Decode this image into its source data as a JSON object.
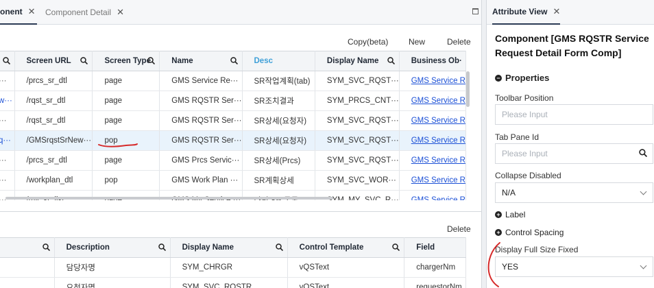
{
  "tabs": [
    {
      "label": "onent",
      "active": true
    },
    {
      "label": "Component Detail",
      "active": false
    }
  ],
  "upper_toolbar": {
    "copy": "Copy(beta)",
    "new": "New",
    "delete": "Delete"
  },
  "upper_grid": {
    "headers": [
      "Screen URL",
      "Screen Type",
      "Name",
      "Desc",
      "Display Name",
      "Business Ob·"
    ],
    "rows": [
      {
        "c0": "···",
        "url": "/prcs_sr_dtl",
        "type": "page",
        "name": "GMS Service Re···",
        "desc": "SR작업계획(tab)",
        "display": "SYM_SVC_RQST···",
        "bo": "GMS Service R"
      },
      {
        "c0": "w···",
        "url": "/rqst_sr_dtl",
        "type": "page",
        "name": "GMS RQSTR Ser···",
        "desc": "SR조치결과",
        "display": "SYM_PRCS_CNT···",
        "bo": "GMS Service R"
      },
      {
        "c0": "···",
        "url": "/rqst_sr_dtl",
        "type": "page",
        "name": "GMS RQSTR Ser···",
        "desc": "SR상세(요청자)",
        "display": "SYM_SVC_RQST···",
        "bo": "GMS Service R"
      },
      {
        "c0": "q···",
        "url": "/GMSrqstSrNew···",
        "type": "pop",
        "name": "GMS RQSTR Ser···",
        "desc": "SR상세(요청자)",
        "display": "SYM_SVC_RQST···",
        "bo": "GMS Service R",
        "selected": true
      },
      {
        "c0": "···",
        "url": "/prcs_sr_dtl",
        "type": "page",
        "name": "GMS Prcs Servic···",
        "desc": "SR상세(Prcs)",
        "display": "SYM_SVC_RQST···",
        "bo": "GMS Service R"
      },
      {
        "c0": "···",
        "url": "/workplan_dtl",
        "type": "pop",
        "name": "GMS Work Plan ···",
        "desc": "SR계획상세",
        "display": "SYM_SVC_WOR···",
        "bo": "GMS Service R"
      },
      {
        "c0": "···",
        "url": "/my_sr_list",
        "type": "page",
        "name": "GMS My Service ···",
        "desc": "나의 SR 목록",
        "display": "SYM_MY_SVC_R···",
        "bo": "GMS Service R"
      }
    ]
  },
  "lower_toolbar": {
    "delete": "Delete"
  },
  "lower_grid": {
    "headers": [
      "Description",
      "Display Name",
      "Control Template",
      "Field"
    ],
    "rows": [
      {
        "desc": "담당자명",
        "display": "SYM_CHRGR",
        "tmpl": "vQSText",
        "field": "chargerNm"
      },
      {
        "desc": "요청자명",
        "display": "SYM_SVC_RQSTR",
        "tmpl": "vQSText",
        "field": "requestorNm"
      }
    ]
  },
  "attribute": {
    "tab_label": "Attribute View",
    "title": "Component [GMS RQSTR Service Request Detail Form Comp]",
    "properties": "Properties",
    "toolbar_position": {
      "label": "Toolbar Position",
      "placeholder": "Please Input"
    },
    "tab_pane_id": {
      "label": "Tab Pane Id",
      "placeholder": "Please Input"
    },
    "collapse_disabled": {
      "label": "Collapse Disabled",
      "value": "N/A"
    },
    "label_section": "Label",
    "control_spacing": "Control Spacing",
    "display_full_size_fixed": {
      "label": "Display Full Size Fixed",
      "value": "YES"
    }
  },
  "colors": {
    "accent_header": "#3fa0d8",
    "link": "#1a4fd6",
    "selected_row": "#e9f3fc",
    "annotation": "#d62a2a"
  }
}
